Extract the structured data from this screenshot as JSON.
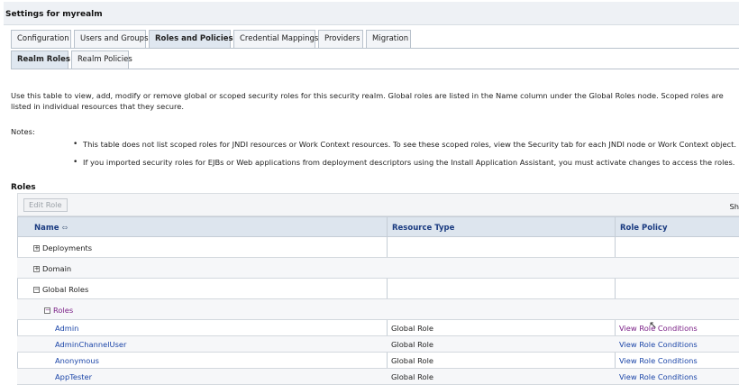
{
  "page": {
    "title": "Settings for myrealm"
  },
  "tabs": [
    {
      "label": "Configuration",
      "active": false
    },
    {
      "label": "Users and Groups",
      "active": false
    },
    {
      "label": "Roles and Policies",
      "active": true
    },
    {
      "label": "Credential Mappings",
      "active": false
    },
    {
      "label": "Providers",
      "active": false
    },
    {
      "label": "Migration",
      "active": false
    }
  ],
  "subtabs": [
    {
      "label": "Realm Roles",
      "active": true
    },
    {
      "label": "Realm Policies",
      "active": false
    }
  ],
  "intro": {
    "text": "Use this table to view, add, modify or remove global or scoped security roles for this security realm. Global roles are listed in the Name column under the Global Roles node. Scoped roles are listed in individual resources that they secure."
  },
  "notes": {
    "label": "Notes:",
    "items": [
      "This table does not list scoped roles for JNDI resources or Work Context resources. To see these scoped roles, view the Security tab for each JNDI node or Work Context object.",
      "If you imported security roles for EJBs or Web applications from deployment descriptors using the Install Application Assistant, you must activate changes to access the roles."
    ]
  },
  "roles": {
    "heading": "Roles",
    "edit_button": "Edit Role",
    "show_text": "Sh",
    "columns": {
      "name": "Name",
      "resource_type": "Resource Type",
      "role_policy": "Role Policy"
    },
    "rows": [
      {
        "name": "Deployments",
        "expand": "+",
        "resource_type": "",
        "role_policy": ""
      },
      {
        "name": "Domain",
        "expand": "+",
        "resource_type": "",
        "role_policy": ""
      },
      {
        "name": "Global Roles",
        "expand": "−",
        "resource_type": "",
        "role_policy": ""
      },
      {
        "name": "Roles",
        "expand": "−",
        "resource_type": "",
        "role_policy": ""
      },
      {
        "name": "Admin",
        "resource_type": "Global Role",
        "role_policy": "View Role Conditions"
      },
      {
        "name": "AdminChannelUser",
        "resource_type": "Global Role",
        "role_policy": "View Role Conditions"
      },
      {
        "name": "Anonymous",
        "resource_type": "Global Role",
        "role_policy": "View Role Conditions"
      },
      {
        "name": "AppTester",
        "resource_type": "Global Role",
        "role_policy": "View Role Conditions"
      }
    ]
  },
  "colors": {
    "link": "#1b45a8",
    "visited_link": "#7a1f86",
    "header_text": "#1a3b80"
  }
}
